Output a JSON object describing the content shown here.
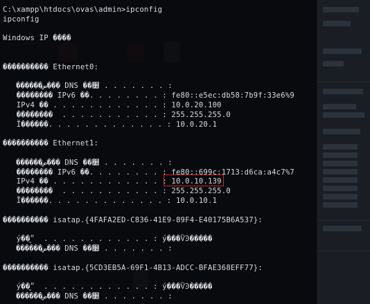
{
  "terminal": {
    "lines": [
      "C:\\xampp\\htdocs\\ovas\\admin>ipconfig",
      "ipconfig",
      "",
      "Windows IP ����",
      "",
      "",
      "���������� Ethernet0:",
      "",
      "   ������ض��� DNS ��׺ . . . . . . . :",
      "   �������� IPv6 ��. . . . . . . . : fe80::e5ec:db58:7b9f:33e6%9",
      "   IPv4 �� . . . . . . . . . . . . : 10.0.20.100",
      "   ��������  . . . . . . . . . . . : 255.255.255.0",
      "   Ĭ������. . . . . . . . . . . . . : 10.0.20.1",
      "",
      "���������� Ethernet1:",
      "",
      "   ������ض��� DNS ��׺ . . . . . . . :",
      "   �������� IPv6 ��. . . . . . . . : fe80::699c:1713:d6ca:a4c7%7",
      "   IPv4 �� . . . . . . . . . . . . : 10.0.10.139",
      "   ��������  . . . . . . . . . . . : 255.255.255.0",
      "   Ĭ������. . . . . . . . . . . . . : 10.0.10.1",
      "",
      "���������� isatap.{4FAFA2ED-C836-41E9-89F4-E40175B6A537}:",
      "",
      "   ý��״̬  . . . . . . . . . . . . : ý���ѶϿ�����",
      "   ������ض��� DNS ��׺ . . . . . . . :",
      "",
      "���������� isatap.{5CD3EB5A-69F1-4B13-ADCC-BFAE368EFF77}:",
      "",
      "   ý��״̬  . . . . . . . . . . . . : ý���ѶϿ�����",
      "   ������ض��� DNS ��׺ . . . . . . . :"
    ],
    "highlighted_value": "10.0.10.139"
  },
  "colors": {
    "background": "#0d0f12",
    "text": "#d9dde2",
    "highlight": "#d3232c"
  }
}
